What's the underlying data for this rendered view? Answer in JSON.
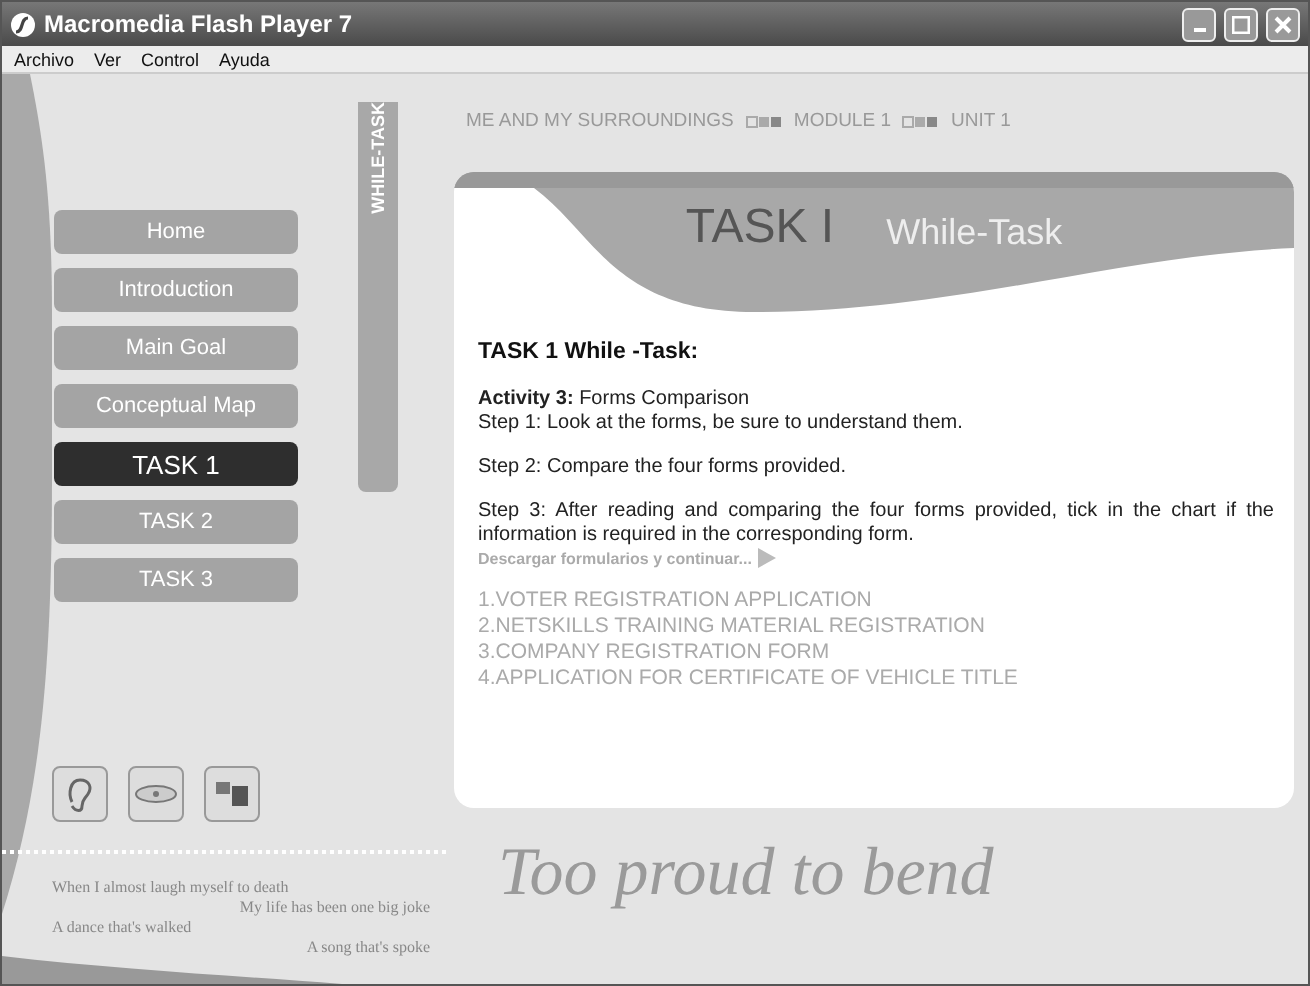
{
  "window": {
    "title": "Macromedia Flash Player 7"
  },
  "menu": [
    "Archivo",
    "Ver",
    "Control",
    "Ayuda"
  ],
  "side_tab": "WHILE-TASK",
  "breadcrumb": [
    "ME  AND MY SURROUNDINGS",
    "MODULE 1",
    "UNIT 1"
  ],
  "nav": [
    {
      "label": "Home",
      "selected": false
    },
    {
      "label": "Introduction",
      "selected": false
    },
    {
      "label": "Main Goal",
      "selected": false
    },
    {
      "label": "Conceptual Map",
      "selected": false
    },
    {
      "label": "TASK 1",
      "selected": true
    },
    {
      "label": "TASK 2",
      "selected": false
    },
    {
      "label": "TASK 3",
      "selected": false
    }
  ],
  "card": {
    "title": "TASK  I",
    "subtitle": "While-Task",
    "heading": "TASK 1 While -Task:",
    "activity": "**Activity 3:** Forms Comparison",
    "steps": [
      "Step 1: Look at the forms, be sure to understand them.",
      "Step 2: Compare the four forms provided.",
      "Step 3: After reading and comparing the four forms provided, tick in the chart if the information is required in the corresponding form."
    ],
    "link": "Descargar formularios y continuar...",
    "forms": [
      "1.VOTER REGISTRATION APPLICATION",
      "2.NETSKILLS TRAINING MATERIAL REGISTRATION",
      "3.COMPANY REGISTRATION FORM",
      "4.APPLICATION FOR CERTIFICATE OF VEHICLE TITLE"
    ]
  },
  "tools": [
    {
      "kind": "ear"
    },
    {
      "kind": "disc"
    },
    {
      "kind": "squares"
    }
  ],
  "lyrics": [
    "When I almost laugh myself to death",
    "My life has been one big joke",
    "A dance that's walked",
    "A song that's spoke"
  ],
  "motto": "Too proud to bend"
}
